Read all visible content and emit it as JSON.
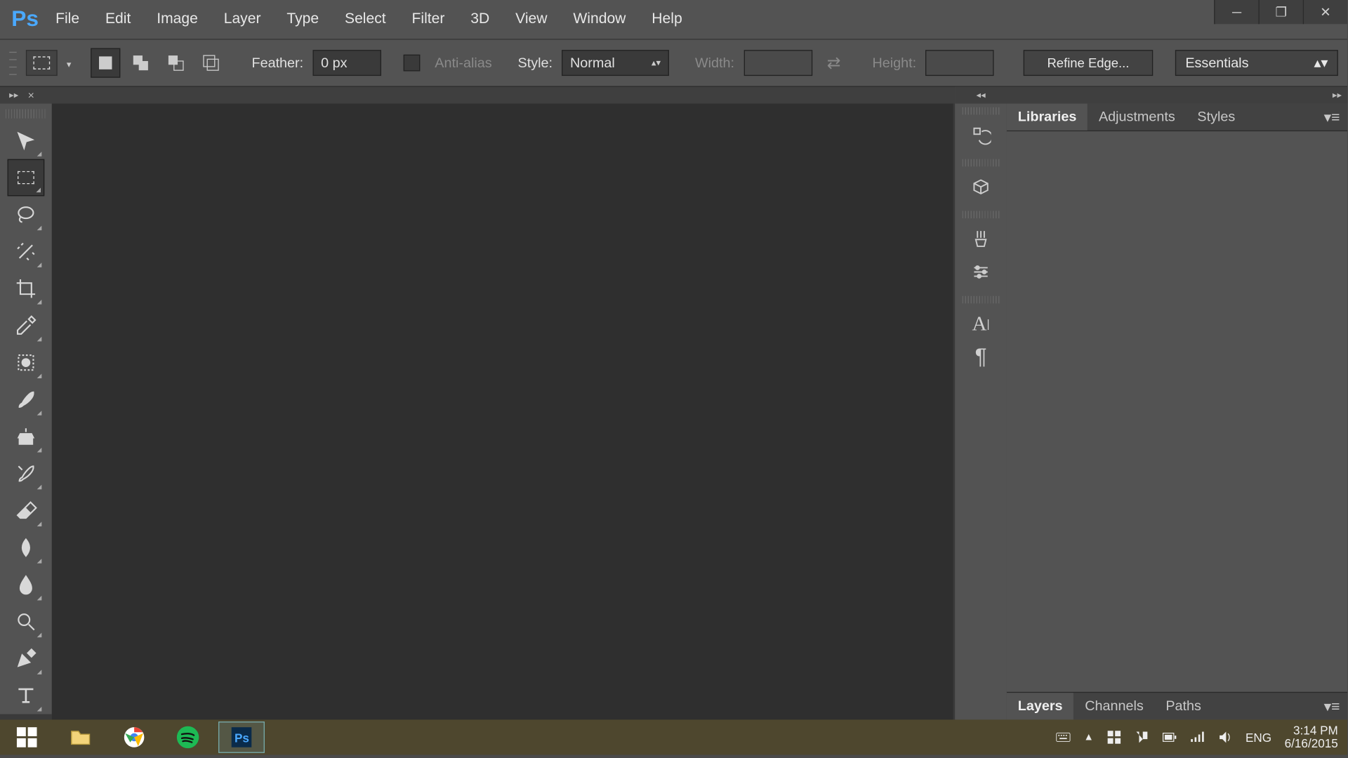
{
  "menubar": {
    "items": [
      "File",
      "Edit",
      "Image",
      "Layer",
      "Type",
      "Select",
      "Filter",
      "3D",
      "View",
      "Window",
      "Help"
    ]
  },
  "optionsbar": {
    "feather_label": "Feather:",
    "feather_value": "0 px",
    "antialias_label": "Anti-alias",
    "style_label": "Style:",
    "style_value": "Normal",
    "width_label": "Width:",
    "height_label": "Height:",
    "refine_label": "Refine Edge...",
    "workspace_value": "Essentials"
  },
  "tools": [
    {
      "name": "move-tool"
    },
    {
      "name": "rectangular-marquee-tool",
      "active": true
    },
    {
      "name": "lasso-tool"
    },
    {
      "name": "magic-wand-tool"
    },
    {
      "name": "crop-tool"
    },
    {
      "name": "eyedropper-tool"
    },
    {
      "name": "spot-healing-brush-tool"
    },
    {
      "name": "brush-tool"
    },
    {
      "name": "clone-stamp-tool"
    },
    {
      "name": "history-brush-tool"
    },
    {
      "name": "eraser-tool"
    },
    {
      "name": "gradient-tool"
    },
    {
      "name": "blur-tool"
    },
    {
      "name": "dodge-tool"
    },
    {
      "name": "pen-tool"
    },
    {
      "name": "type-tool"
    }
  ],
  "right_panels": {
    "top_tabs": [
      "Libraries",
      "Adjustments",
      "Styles"
    ],
    "top_active": 0,
    "bottom_tabs": [
      "Layers",
      "Channels",
      "Paths"
    ],
    "bottom_active": 0,
    "icon_buttons": [
      {
        "name": "history-icon"
      },
      {
        "name": "3d-icon"
      },
      {
        "name": "brush-presets-icon"
      },
      {
        "name": "adjustments-sliders-icon"
      },
      {
        "name": "character-icon"
      },
      {
        "name": "paragraph-icon"
      }
    ]
  },
  "taskbar": {
    "items": [
      {
        "name": "start-button"
      },
      {
        "name": "file-explorer"
      },
      {
        "name": "chrome"
      },
      {
        "name": "spotify"
      },
      {
        "name": "photoshop",
        "active": true
      }
    ],
    "lang": "ENG",
    "time": "3:14 PM",
    "date": "6/16/2015"
  }
}
